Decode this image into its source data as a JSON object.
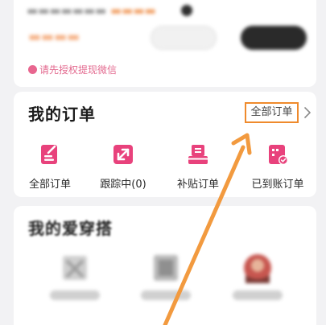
{
  "top_card": {
    "tip": "请先授权提现微信"
  },
  "orders": {
    "title": "我的订单",
    "all_link": "全部订单",
    "items": [
      {
        "label": "全部订单",
        "icon": "all-orders-icon"
      },
      {
        "label": "跟踪中(0)",
        "icon": "tracking-icon"
      },
      {
        "label": "补贴订单",
        "icon": "subsidy-orders-icon"
      },
      {
        "label": "已到账订单",
        "icon": "credited-orders-icon"
      }
    ]
  },
  "outfit": {
    "title": "我的爱穿搭"
  },
  "colors": {
    "accent_pink": "#e8427c",
    "highlight_orange": "#ef8a2c",
    "arrow_orange": "#f29a3f"
  }
}
